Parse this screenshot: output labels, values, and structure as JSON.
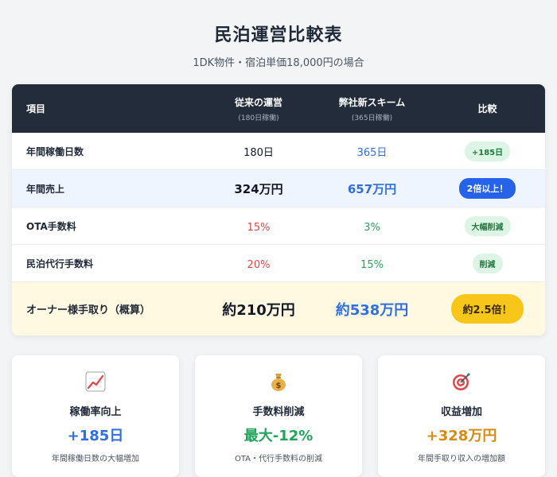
{
  "header": {
    "title": "民泊運営比較表",
    "subtitle": "1DK物件・宿泊単価18,000円の場合"
  },
  "table": {
    "columns": [
      {
        "label": "項目",
        "sub": ""
      },
      {
        "label": "従来の運営",
        "sub": "(180日稼働)"
      },
      {
        "label": "弊社新スキーム",
        "sub": "(365日稼働)"
      },
      {
        "label": "比較",
        "sub": ""
      }
    ],
    "rows": [
      {
        "item": "年間稼働日数",
        "traditional": "180日",
        "new": "365日",
        "compare": "+185日"
      },
      {
        "item": "年間売上",
        "traditional": "324万円",
        "new": "657万円",
        "compare": "2倍以上！"
      },
      {
        "item": "OTA手数料",
        "traditional": "15%",
        "new": "3%",
        "compare": "大幅削減"
      },
      {
        "item": "民泊代行手数料",
        "traditional": "20%",
        "new": "15%",
        "compare": "削減"
      },
      {
        "item": "オーナー様手取り（概算）",
        "traditional": "約210万円",
        "new": "約538万円",
        "compare": "約2.5倍！"
      }
    ]
  },
  "cards": [
    {
      "icon": "chart-up-icon",
      "label": "稼働率向上",
      "value": "+185日",
      "desc": "年間稼働日数の大幅増加",
      "color": "#2f6fe0"
    },
    {
      "icon": "money-bag-icon",
      "label": "手数料削減",
      "value": "最大-12%",
      "desc": "OTA・代行手数料の削減",
      "color": "#22a55a"
    },
    {
      "icon": "target-icon",
      "label": "収益増加",
      "value": "+328万円",
      "desc": "年間手取り収入の増加額",
      "color": "#d98a12"
    }
  ],
  "colors": {
    "header_bg": "#232c3b",
    "accent_blue": "#2f6fe0",
    "accent_green": "#22a55a",
    "accent_red": "#e04646",
    "accent_gold": "#f8c619"
  }
}
